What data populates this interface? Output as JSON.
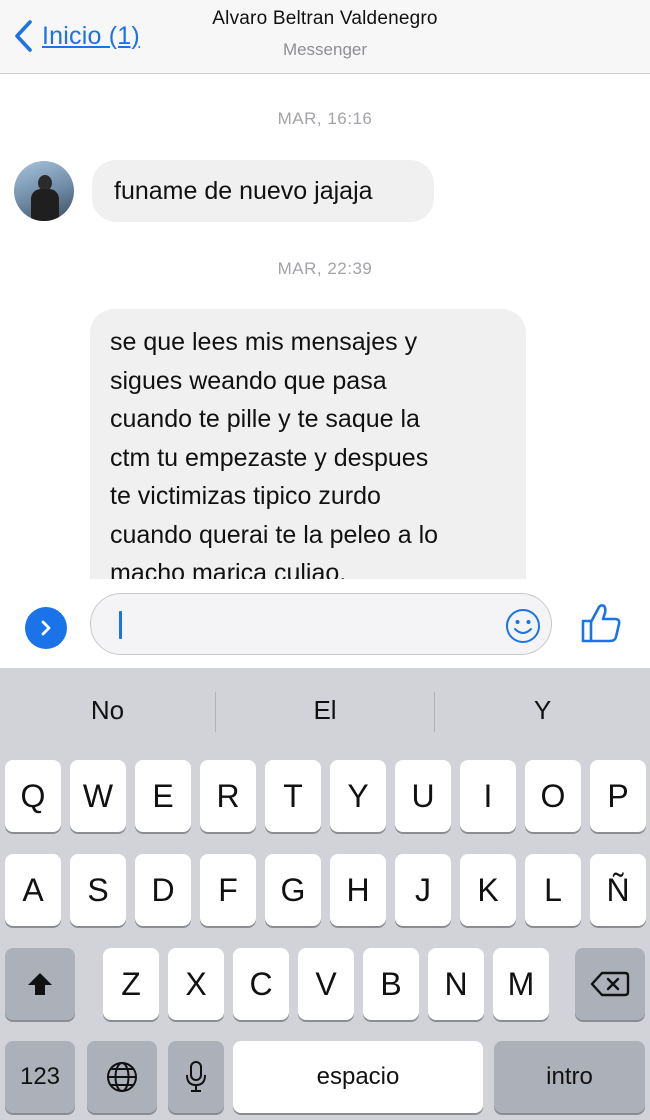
{
  "header": {
    "back_label": "Inicio (1)",
    "title": "Alvaro Beltran Valdenegro",
    "subtitle": "Messenger"
  },
  "conversation": {
    "timestamps": [
      "MAR, 16:16",
      "MAR, 22:39"
    ],
    "messages": [
      {
        "sender": "incoming",
        "lines": [
          "funame de nuevo jajaja"
        ]
      },
      {
        "sender": "incoming",
        "lines": [
          "se que lees mis mensajes y",
          "sigues weando que pasa",
          "cuando te pille y te saque la",
          "ctm tu empezaste y despues",
          "te victimizas tipico zurdo",
          "cuando querai te  la peleo a lo",
          "macho marica culiao."
        ]
      }
    ]
  },
  "composer": {
    "input_value": "",
    "expand_icon": "chevron-right-icon",
    "emoji_icon": "smiley-icon",
    "like_icon": "thumbs-up-icon",
    "accent_color": "#1a73e8"
  },
  "keyboard": {
    "suggestions": [
      "No",
      "El",
      "Y"
    ],
    "row1": [
      "Q",
      "W",
      "E",
      "R",
      "T",
      "Y",
      "U",
      "I",
      "O",
      "P"
    ],
    "row2": [
      "A",
      "S",
      "D",
      "F",
      "G",
      "H",
      "J",
      "K",
      "L",
      "Ñ"
    ],
    "row3": [
      "Z",
      "X",
      "C",
      "V",
      "B",
      "N",
      "M"
    ],
    "numbers_label": "123",
    "space_label": "espacio",
    "return_label": "intro",
    "shift_icon": "shift-arrow-icon",
    "delete_icon": "backspace-icon",
    "globe_icon": "globe-icon",
    "mic_icon": "microphone-icon"
  }
}
